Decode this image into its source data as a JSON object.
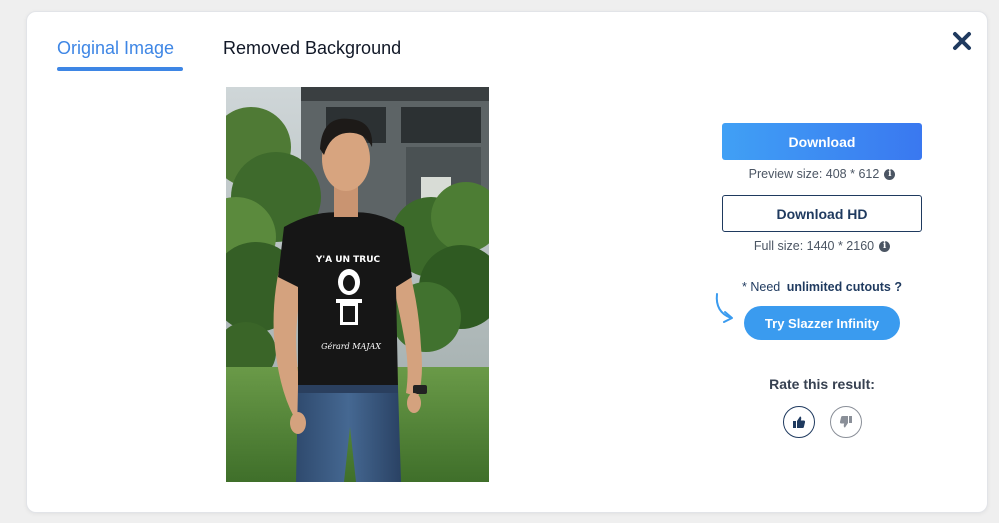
{
  "tabs": {
    "original": "Original Image",
    "removed": "Removed Background"
  },
  "image": {
    "shirt_text_top": "Y'A UN TRUC",
    "shirt_signature": "Gérard MAJAX"
  },
  "download": {
    "label": "Download",
    "preview_size": "Preview size: 408 * 612"
  },
  "download_hd": {
    "label": "Download HD",
    "full_size": "Full size: 1440 * 2160"
  },
  "promo": {
    "prefix": "* Need",
    "emphasis": "unlimited cutouts ?",
    "button_label": "Try Slazzer Infinity"
  },
  "rating": {
    "title": "Rate this result:"
  },
  "colors": {
    "accent": "#3e86e5",
    "navy": "#1f3a5f",
    "button_blue": "#3a9bef"
  }
}
